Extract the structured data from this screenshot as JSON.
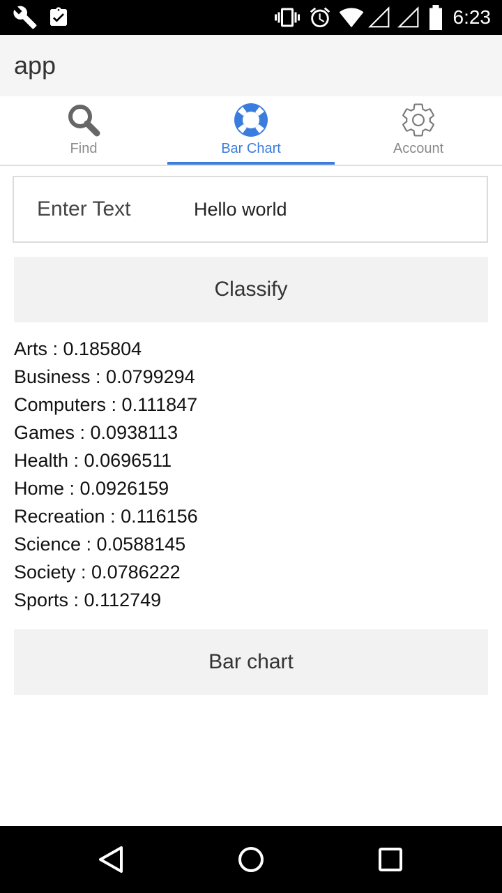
{
  "status_bar": {
    "time": "6:23",
    "left_icons": [
      "wrench-icon",
      "clipboard-check-icon"
    ],
    "right_icons": [
      "vibrate-icon",
      "alarm-icon",
      "wifi-icon",
      "signal-icon",
      "signal-icon",
      "battery-icon"
    ]
  },
  "app_bar": {
    "title": "app"
  },
  "tabs": [
    {
      "label": "Find",
      "icon": "search-icon",
      "active": false
    },
    {
      "label": "Bar Chart",
      "icon": "lifebuoy-icon",
      "active": true
    },
    {
      "label": "Account",
      "icon": "gear-icon",
      "active": false
    }
  ],
  "input": {
    "label": "Enter Text",
    "value": "Hello world"
  },
  "classify_button": {
    "label": "Classify"
  },
  "results": [
    "Arts : 0.185804",
    "Business : 0.0799294",
    "Computers : 0.111847",
    "Games : 0.0938113",
    "Health : 0.0696511",
    "Home : 0.0926159",
    "Recreation : 0.116156",
    "Science : 0.0588145",
    "Society : 0.0786222",
    "Sports : 0.112749"
  ],
  "barchart_button": {
    "label": "Bar chart"
  },
  "nav_bar": {
    "icons": [
      "back-icon",
      "home-icon",
      "recents-icon"
    ]
  },
  "colors": {
    "accent": "#3b7ddd",
    "status_bar": "#000000",
    "app_bar": "#f5f5f5",
    "button": "#f2f2f2"
  }
}
